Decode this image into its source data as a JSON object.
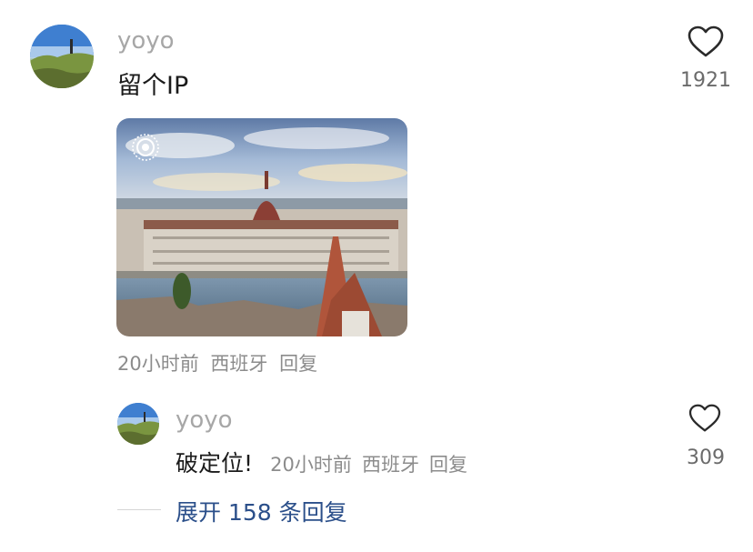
{
  "comment": {
    "username": "yoyo",
    "text": "留个IP",
    "like_count": "1921",
    "time": "20小时前",
    "location": "西班牙",
    "reply_label": "回复",
    "like_icon": "heart-outline-icon",
    "avatar_icon": "landscape-avatar",
    "photo_icon": "live-photo-icon"
  },
  "reply": {
    "username": "yoyo",
    "text": "破定位!",
    "like_count": "309",
    "time": "20小时前",
    "location": "西班牙",
    "reply_label": "回复",
    "like_icon": "heart-outline-icon"
  },
  "expand": {
    "label": "展开 158 条回复"
  },
  "colors": {
    "username": "#a7a7a7",
    "meta": "#8c8c8c",
    "expand_link": "#2b4f8a"
  }
}
